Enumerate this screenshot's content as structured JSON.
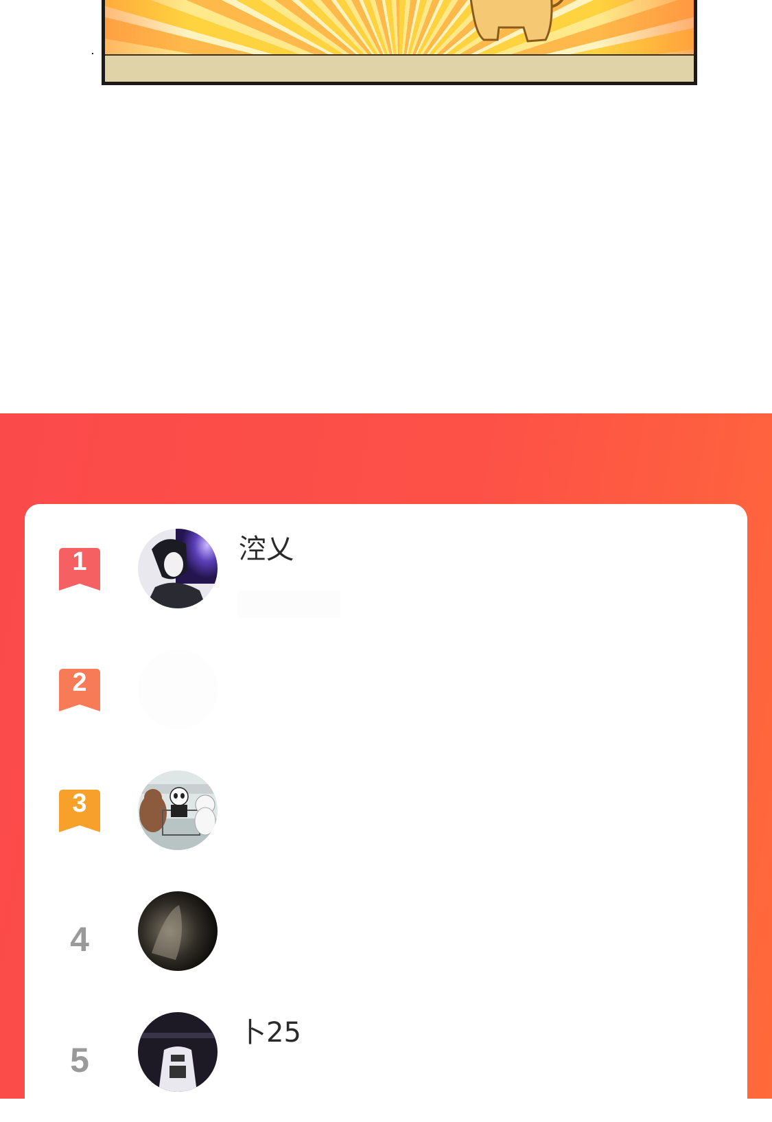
{
  "comic": {
    "colors": {
      "burst": "#ffd23f",
      "floor": "#e0d3a8",
      "outline": "#1c1a18"
    }
  },
  "ranking": {
    "title": "",
    "colors": {
      "background": "#fd4c48",
      "gold": "#f56063",
      "silver": "#f87b58",
      "bronze": "#f7a02a",
      "plain": "#9a9a9a"
    },
    "entries": [
      {
        "rank": "1",
        "name": "涳乂",
        "badge": "red-bookmark-icon"
      },
      {
        "rank": "2",
        "name": "",
        "badge": "orange-bookmark-icon"
      },
      {
        "rank": "3",
        "name": "",
        "badge": "amber-bookmark-icon"
      },
      {
        "rank": "4",
        "name": "",
        "badge": ""
      },
      {
        "rank": "5",
        "name": "卜25",
        "badge": ""
      }
    ]
  }
}
